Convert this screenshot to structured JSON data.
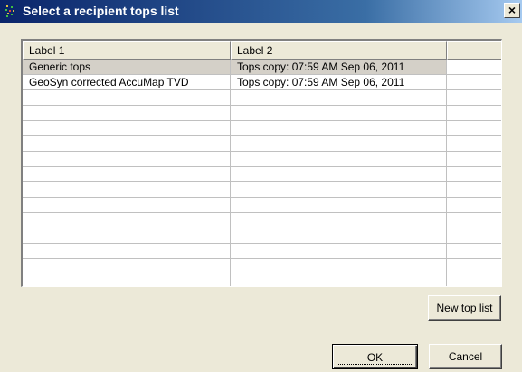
{
  "dialog": {
    "title": "Select a recipient tops list",
    "close_label": "×"
  },
  "table": {
    "columns": [
      "Label 1",
      "Label 2",
      ""
    ],
    "rows": [
      {
        "label1": "Generic tops",
        "label2": "Tops copy: 07:59 AM Sep 06, 2011",
        "selected": true
      },
      {
        "label1": "GeoSyn corrected AccuMap TVD",
        "label2": "Tops copy: 07:59 AM Sep 06, 2011",
        "selected": false
      },
      {
        "label1": "",
        "label2": ""
      },
      {
        "label1": "",
        "label2": ""
      },
      {
        "label1": "",
        "label2": ""
      },
      {
        "label1": "",
        "label2": ""
      },
      {
        "label1": "",
        "label2": ""
      },
      {
        "label1": "",
        "label2": ""
      },
      {
        "label1": "",
        "label2": ""
      },
      {
        "label1": "",
        "label2": ""
      },
      {
        "label1": "",
        "label2": ""
      },
      {
        "label1": "",
        "label2": ""
      },
      {
        "label1": "",
        "label2": ""
      },
      {
        "label1": "",
        "label2": ""
      },
      {
        "label1": "",
        "label2": ""
      }
    ]
  },
  "buttons": {
    "new_top_list": "New top list",
    "ok": "OK",
    "cancel": "Cancel"
  },
  "icons": {
    "app": "app-logo-icon",
    "close": "close-icon"
  },
  "colors": {
    "titlebar_start": "#0a246a",
    "titlebar_end": "#a6caf0",
    "dialog_bg": "#ece9d8",
    "selection_bg": "#d4d0c8"
  }
}
